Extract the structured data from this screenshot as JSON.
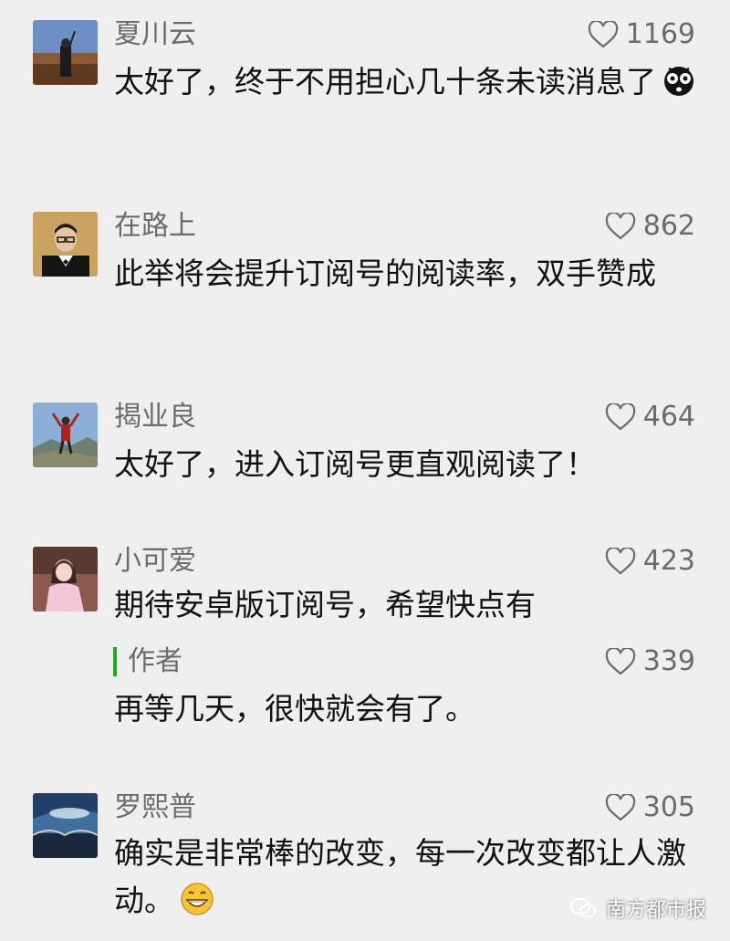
{
  "comments": [
    {
      "name": "夏川云",
      "likes": "1169",
      "text": "太好了，终于不用担心几十条未读消息了",
      "emoji": "shocked-emoji"
    },
    {
      "name": "在路上",
      "likes": "862",
      "text": "此举将会提升订阅号的阅读率，双手赞成"
    },
    {
      "name": "揭业良",
      "likes": "464",
      "text": "太好了，进入订阅号更直观阅读了！"
    },
    {
      "name": "小可爱",
      "likes": "423",
      "text": "期待安卓版订阅号，希望快点有",
      "reply": {
        "name": "作者",
        "likes": "339",
        "text": "再等几天，很快就会有了。"
      }
    },
    {
      "name": "罗熙普",
      "likes": "305",
      "text": "确实是非常棒的改变，每一次改变都让人激动。",
      "emoji": "grin-emoji"
    }
  ],
  "watermark": {
    "text": "南方都市报",
    "icon": "wechat-icon"
  },
  "colors": {
    "background": "#efefef",
    "name": "#6b6b6b",
    "text": "#111111",
    "reply_bar": "#1aad19"
  }
}
